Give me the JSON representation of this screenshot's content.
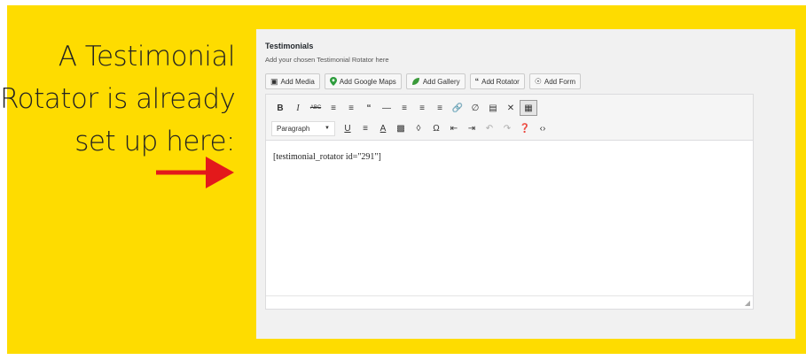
{
  "callout": {
    "line1": "A Testimonial",
    "line2": "Rotator is already",
    "line3": "set up here:"
  },
  "panel": {
    "title": "Testimonials",
    "description": "Add your chosen Testimonial Rotator here"
  },
  "media_buttons": [
    {
      "label": "Add Media",
      "icon": "media-icon"
    },
    {
      "label": "Add Google Maps",
      "icon": "map-pin-icon"
    },
    {
      "label": "Add Gallery",
      "icon": "leaf-icon"
    },
    {
      "label": "Add Rotator",
      "icon": "quote-icon"
    },
    {
      "label": "Add Form",
      "icon": "form-icon"
    }
  ],
  "toolbar": {
    "format_select_value": "Paragraph"
  },
  "editor": {
    "content": "[testimonial_rotator id=\"291\"]"
  },
  "colors": {
    "background": "#fedc00",
    "arrow": "#e3191b",
    "map_pin": "#2d9c3c",
    "leaf": "#3a9a3a"
  }
}
